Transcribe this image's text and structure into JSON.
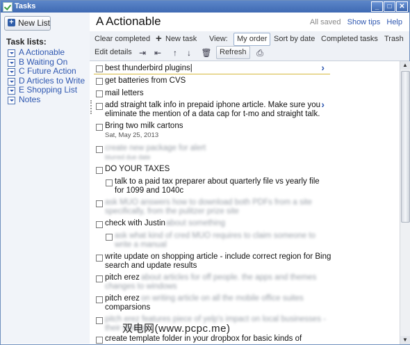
{
  "window": {
    "title": "Tasks"
  },
  "window_controls": [
    "_",
    "□",
    "✕"
  ],
  "sidebar": {
    "new_list_label": "New List",
    "tasklists_heading": "Task lists:",
    "lists": [
      "A Actionable",
      "B Waiting On",
      "C Future Action",
      "D Articles to Write",
      "E Shopping List",
      "Notes"
    ]
  },
  "header": {
    "title": "A Actionable",
    "status": "All saved",
    "show_tips": "Show tips",
    "help": "Help"
  },
  "toolbar": {
    "clear_completed": "Clear completed",
    "new_task": "New task",
    "view_label": "View:",
    "my_order": "My order",
    "sort_by_date": "Sort by date",
    "completed_tasks": "Completed tasks",
    "trash": "Trash",
    "edit_details": "Edit details",
    "refresh": "Refresh"
  },
  "tasks": [
    {
      "text": "best thunderbird plugins"
    },
    {
      "text": "get batteries from CVS"
    },
    {
      "text": "mail letters"
    },
    {
      "text_line1": "add straight talk info in prepaid iphone article. Make sure you",
      "text_line2": "eliminate the mention of a data cap for t-mo and straight talk."
    },
    {
      "text": "Bring two milk cartons",
      "date": "Sat, May 25, 2013"
    },
    {
      "text_line1": "create new package for alert",
      "text_line2": "blurred due date"
    },
    {
      "text": "DO YOUR TAXES"
    },
    {
      "text_line1": "talk to a paid tax preparer about quarterly file vs yearly file",
      "text_line2": "for 1099 and 1040c"
    },
    {
      "text_line1": "ask MUO answers how to download both PDFs from a site",
      "text_line2": "specifically, from the pulitzer prize site"
    },
    {
      "text_start": "check with Justin",
      "text_rest": "about something"
    },
    {
      "text_line1": "ask what kind of cred MUO requires to claim someone to",
      "text_line2": "write a manual"
    },
    {
      "text_line1": "write update on shopping article - include correct region for Bing",
      "text_line2": "search and update results"
    },
    {
      "text_start": "pitch erez",
      "text_rest": "about articles for off people. the apps and themes",
      "text_line2": "changes to windows"
    },
    {
      "text_start": "pitch erez",
      "text_rest": "on writing article on all the mobile office suites",
      "text_line2": "comparsions"
    },
    {
      "text_line1": "pitch erez features piece of yelp's impact on local businesses -",
      "text_line2": "their reviews"
    },
    {
      "text": "create template folder in your dropbox for basic kinds of"
    }
  ],
  "watermark": "双电网(www.pcpc.me)"
}
